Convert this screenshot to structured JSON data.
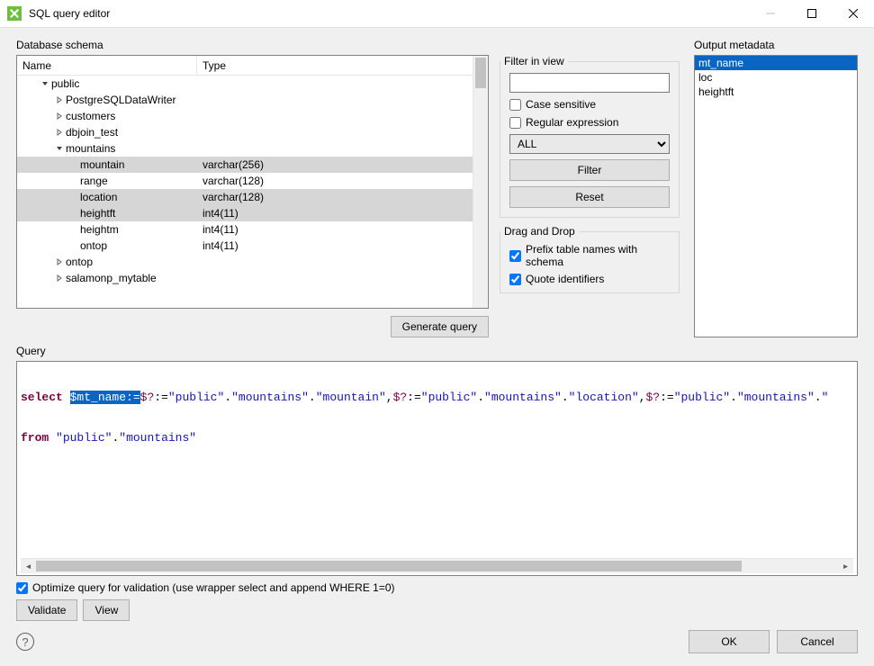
{
  "window": {
    "title": "SQL query editor"
  },
  "schema": {
    "label": "Database schema",
    "col_name": "Name",
    "col_type": "Type",
    "nodes": [
      {
        "indent": 1,
        "exp": "open",
        "label": "public",
        "type": "",
        "sel": false
      },
      {
        "indent": 2,
        "exp": "closed",
        "label": "PostgreSQLDataWriter",
        "type": "",
        "sel": false
      },
      {
        "indent": 2,
        "exp": "closed",
        "label": "customers",
        "type": "",
        "sel": false
      },
      {
        "indent": 2,
        "exp": "closed",
        "label": "dbjoin_test",
        "type": "",
        "sel": false
      },
      {
        "indent": 2,
        "exp": "open",
        "label": "mountains",
        "type": "",
        "sel": false
      },
      {
        "indent": 3,
        "exp": "none",
        "label": "mountain",
        "type": "varchar(256)",
        "sel": true
      },
      {
        "indent": 3,
        "exp": "none",
        "label": "range",
        "type": "varchar(128)",
        "sel": false
      },
      {
        "indent": 3,
        "exp": "none",
        "label": "location",
        "type": "varchar(128)",
        "sel": true
      },
      {
        "indent": 3,
        "exp": "none",
        "label": "heightft",
        "type": "int4(11)",
        "sel": true
      },
      {
        "indent": 3,
        "exp": "none",
        "label": "heightm",
        "type": "int4(11)",
        "sel": false
      },
      {
        "indent": 3,
        "exp": "none",
        "label": "ontop",
        "type": "int4(11)",
        "sel": false
      },
      {
        "indent": 2,
        "exp": "closed",
        "label": "ontop",
        "type": "",
        "sel": false
      },
      {
        "indent": 2,
        "exp": "closed",
        "label": "salamonp_mytable",
        "type": "",
        "sel": false
      }
    ],
    "generate_btn": "Generate query"
  },
  "filter": {
    "legend": "Filter in view",
    "case_sensitive": "Case sensitive",
    "regex": "Regular expression",
    "scope": "ALL",
    "filter_btn": "Filter",
    "reset_btn": "Reset"
  },
  "dragdrop": {
    "legend": "Drag and Drop",
    "prefix": "Prefix table names with schema",
    "quote": "Quote identifiers"
  },
  "output": {
    "label": "Output metadata",
    "items": [
      {
        "text": "mt_name",
        "sel": true
      },
      {
        "text": "loc",
        "sel": false
      },
      {
        "text": "heightft",
        "sel": false
      }
    ]
  },
  "query": {
    "label": "Query",
    "tokens_line1": [
      {
        "t": "kw",
        "v": "select"
      },
      {
        "t": "sp",
        "v": " "
      },
      {
        "t": "hl",
        "v": "$mt_name:="
      },
      {
        "t": "param",
        "v": "$?"
      },
      {
        "t": "assign",
        "v": ":="
      },
      {
        "t": "str",
        "v": "\"public\""
      },
      {
        "t": "punc",
        "v": "."
      },
      {
        "t": "str",
        "v": "\"mountains\""
      },
      {
        "t": "punc",
        "v": "."
      },
      {
        "t": "str",
        "v": "\"mountain\""
      },
      {
        "t": "punc",
        "v": ","
      },
      {
        "t": "param",
        "v": "$?"
      },
      {
        "t": "assign",
        "v": ":="
      },
      {
        "t": "str",
        "v": "\"public\""
      },
      {
        "t": "punc",
        "v": "."
      },
      {
        "t": "str",
        "v": "\"mountains\""
      },
      {
        "t": "punc",
        "v": "."
      },
      {
        "t": "str",
        "v": "\"location\""
      },
      {
        "t": "punc",
        "v": ","
      },
      {
        "t": "param",
        "v": "$?"
      },
      {
        "t": "assign",
        "v": ":="
      },
      {
        "t": "str",
        "v": "\"public\""
      },
      {
        "t": "punc",
        "v": "."
      },
      {
        "t": "str",
        "v": "\"mountains\""
      },
      {
        "t": "punc",
        "v": "."
      },
      {
        "t": "str",
        "v": "\""
      }
    ],
    "tokens_line2": [
      {
        "t": "kw",
        "v": "from"
      },
      {
        "t": "sp",
        "v": " "
      },
      {
        "t": "str",
        "v": "\"public\""
      },
      {
        "t": "punc",
        "v": "."
      },
      {
        "t": "str",
        "v": "\"mountains\""
      }
    ]
  },
  "opts": {
    "optimize": "Optimize query for validation (use wrapper select and append WHERE 1=0)",
    "validate": "Validate",
    "view": "View"
  },
  "footer": {
    "ok": "OK",
    "cancel": "Cancel"
  }
}
